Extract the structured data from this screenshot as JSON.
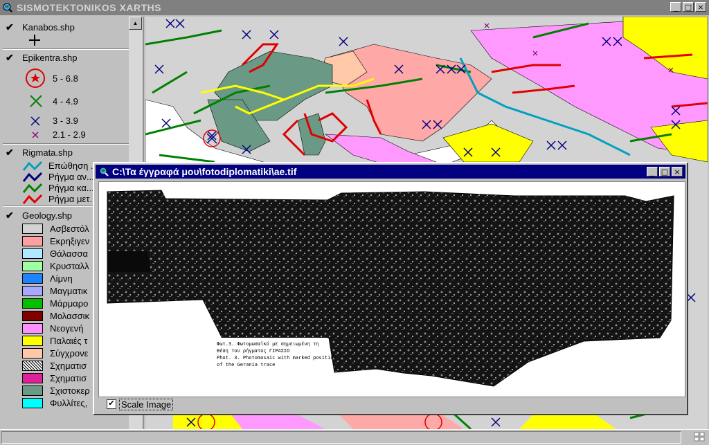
{
  "app": {
    "title": "SISMOTEKTONIKOS XARTHS",
    "window_buttons": [
      "_",
      "□",
      "×"
    ]
  },
  "toc": {
    "layers": [
      {
        "name": "Kanabos.shp",
        "checked": true,
        "legend": [
          {
            "label": "",
            "symbol": "cross"
          }
        ]
      },
      {
        "name": "Epikentra.shp",
        "checked": true,
        "legend": [
          {
            "label": "5 - 6.8",
            "symbol": "star-circle",
            "color": "#e00000"
          },
          {
            "label": "4 - 4.9",
            "symbol": "x-large",
            "color": "#008000"
          },
          {
            "label": "3 - 3.9",
            "symbol": "x-medium",
            "color": "#000080"
          },
          {
            "label": "2.1 - 2.9",
            "symbol": "x-small",
            "color": "#800080"
          }
        ]
      },
      {
        "name": "Rigmata.shp",
        "checked": true,
        "legend": [
          {
            "label": "Επώθηση ...",
            "color": "#00a0c0"
          },
          {
            "label": "Ρήγμα αν...",
            "color": "#000080"
          },
          {
            "label": "Ρήγμα κα...",
            "color": "#008000"
          },
          {
            "label": "Ρήγμα μετ...",
            "color": "#e00000"
          }
        ]
      },
      {
        "name": "Geology.shp",
        "checked": true,
        "legend": [
          {
            "label": "Ασβεστόλ",
            "color": "#d3d3d3"
          },
          {
            "label": "Εκρηξιγεν",
            "color": "#ffa0a0"
          },
          {
            "label": "Θάλασσα",
            "color": "#b0e8ff"
          },
          {
            "label": "Κρυσταλλ",
            "color": "#a0ffa0"
          },
          {
            "label": "Λίμνη",
            "color": "#1c84ff"
          },
          {
            "label": "Μαγματικ",
            "color": "#a8a8ff"
          },
          {
            "label": "Μάρμαρο",
            "color": "#00c000"
          },
          {
            "label": "Μολασσικ",
            "color": "#800000"
          },
          {
            "label": "Νεογενή",
            "color": "#ff90ff"
          },
          {
            "label": "Παλαιές τ",
            "color": "#ffff00"
          },
          {
            "label": "Σύγχρονε",
            "color": "#ffc8a8"
          },
          {
            "label": "Σχηματισ",
            "color": "pattern"
          },
          {
            "label": "Σχηματισ",
            "color": "#e0209a"
          },
          {
            "label": "Σχιστοκερ",
            "color": "#6a9a86"
          },
          {
            "label": "Φυλλίτες,",
            "color": "#00ffff"
          }
        ]
      }
    ]
  },
  "image_window": {
    "title": "C:\\Τα έγγραφά μου\\fotodiplomatiki\\ae.tif",
    "scale_image_label": "Scale Image",
    "scale_image_checked": true,
    "caption_line1": "Φωτ.3. Φωτομωσαϊκό με σημειωμένη τη",
    "caption_line2": "θέση του ρήγματος ΓΙΡΑΣΙΟ",
    "caption_line3": "Phot. 3. Photomosaic with marked position",
    "caption_line4": "of the Gerania trace"
  },
  "colors": {
    "title_active": "#000080",
    "title_inactive": "#808080",
    "face": "#c0c0c0"
  }
}
